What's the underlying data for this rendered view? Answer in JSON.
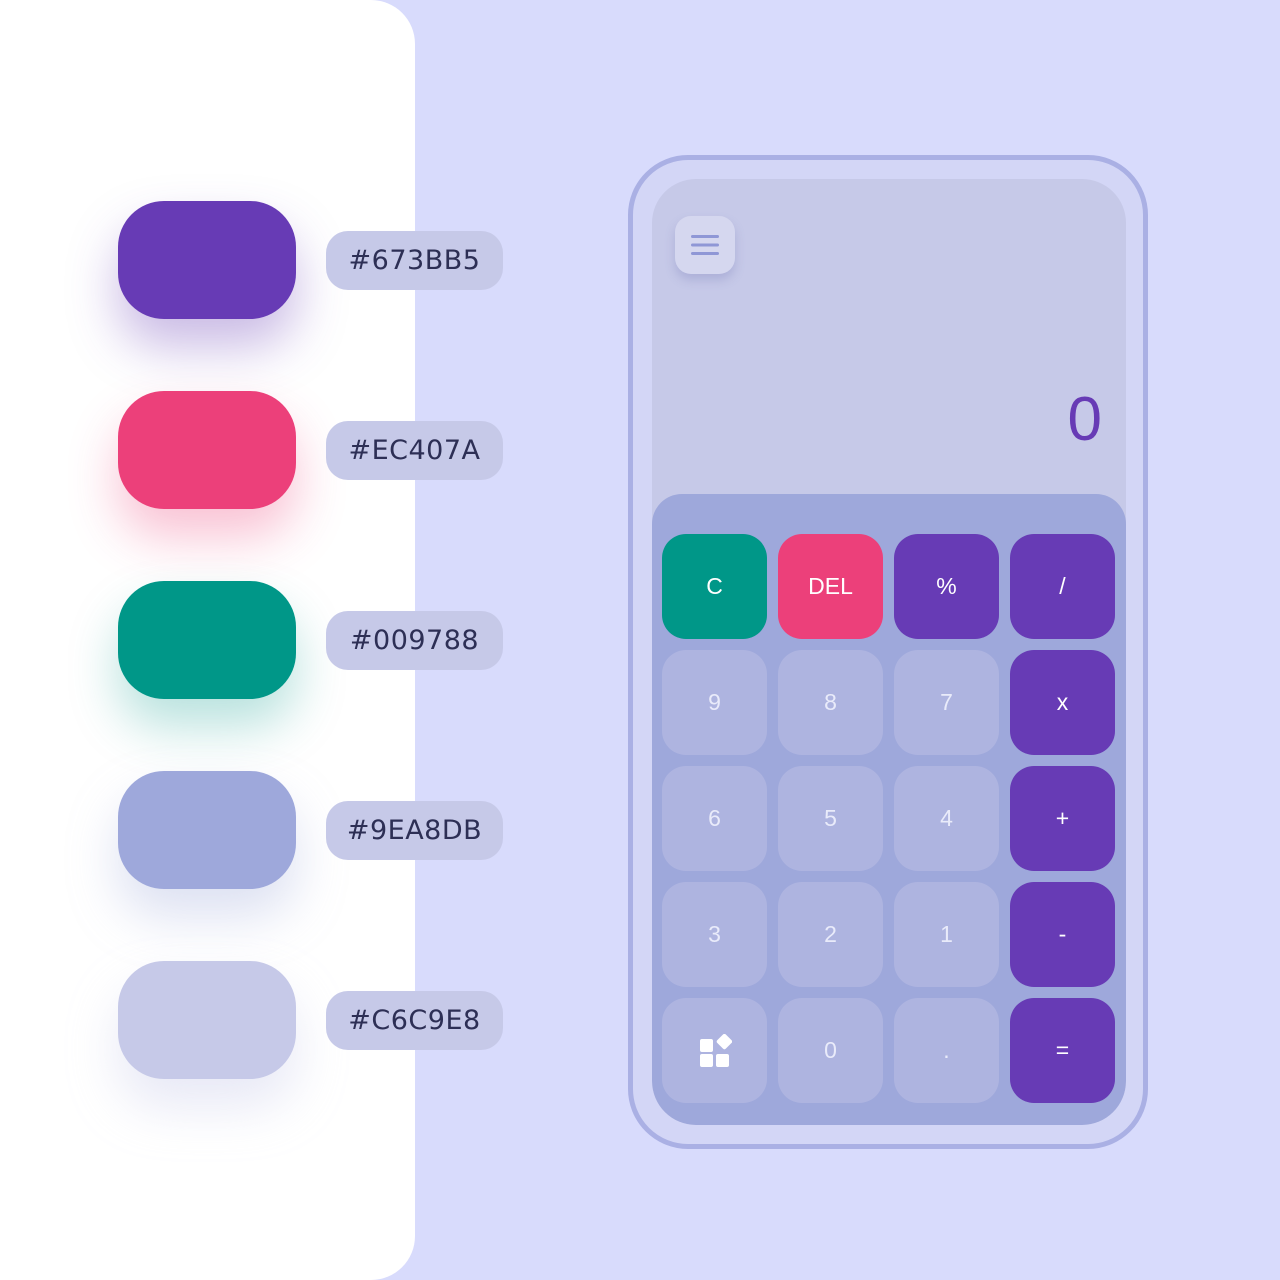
{
  "palette": {
    "swatches": [
      {
        "hex": "#673BB5",
        "label": "#673BB5",
        "shadow": "rgba(103,59,181,0.35)"
      },
      {
        "hex": "#EC407A",
        "label": "#EC407A",
        "shadow": "rgba(236,64,122,0.32)"
      },
      {
        "hex": "#009788",
        "label": "#009788",
        "shadow": "rgba(0,151,136,0.28)"
      },
      {
        "hex": "#9EA8DB",
        "label": "#9EA8DB",
        "shadow": "rgba(158,168,219,0.35)"
      },
      {
        "hex": "#C6C9E8",
        "label": "#C6C9E8",
        "shadow": "rgba(198,201,232,0.40)"
      }
    ]
  },
  "calculator": {
    "display": "0",
    "menu_icon": "hamburger-menu-icon",
    "keys": [
      [
        "C",
        "DEL",
        "%",
        "/"
      ],
      [
        "9",
        "8",
        "7",
        "x"
      ],
      [
        "6",
        "5",
        "4",
        "+"
      ],
      [
        "3",
        "2",
        "1",
        "-"
      ],
      [
        "",
        "0",
        ".",
        "="
      ]
    ],
    "apps_icon": "apps-grid-icon",
    "colors": {
      "accent": "#673BB5",
      "clear": "#009788",
      "delete": "#EC407A",
      "keypad": "#9EA8DB",
      "display_bg": "#C6C9E8"
    }
  }
}
